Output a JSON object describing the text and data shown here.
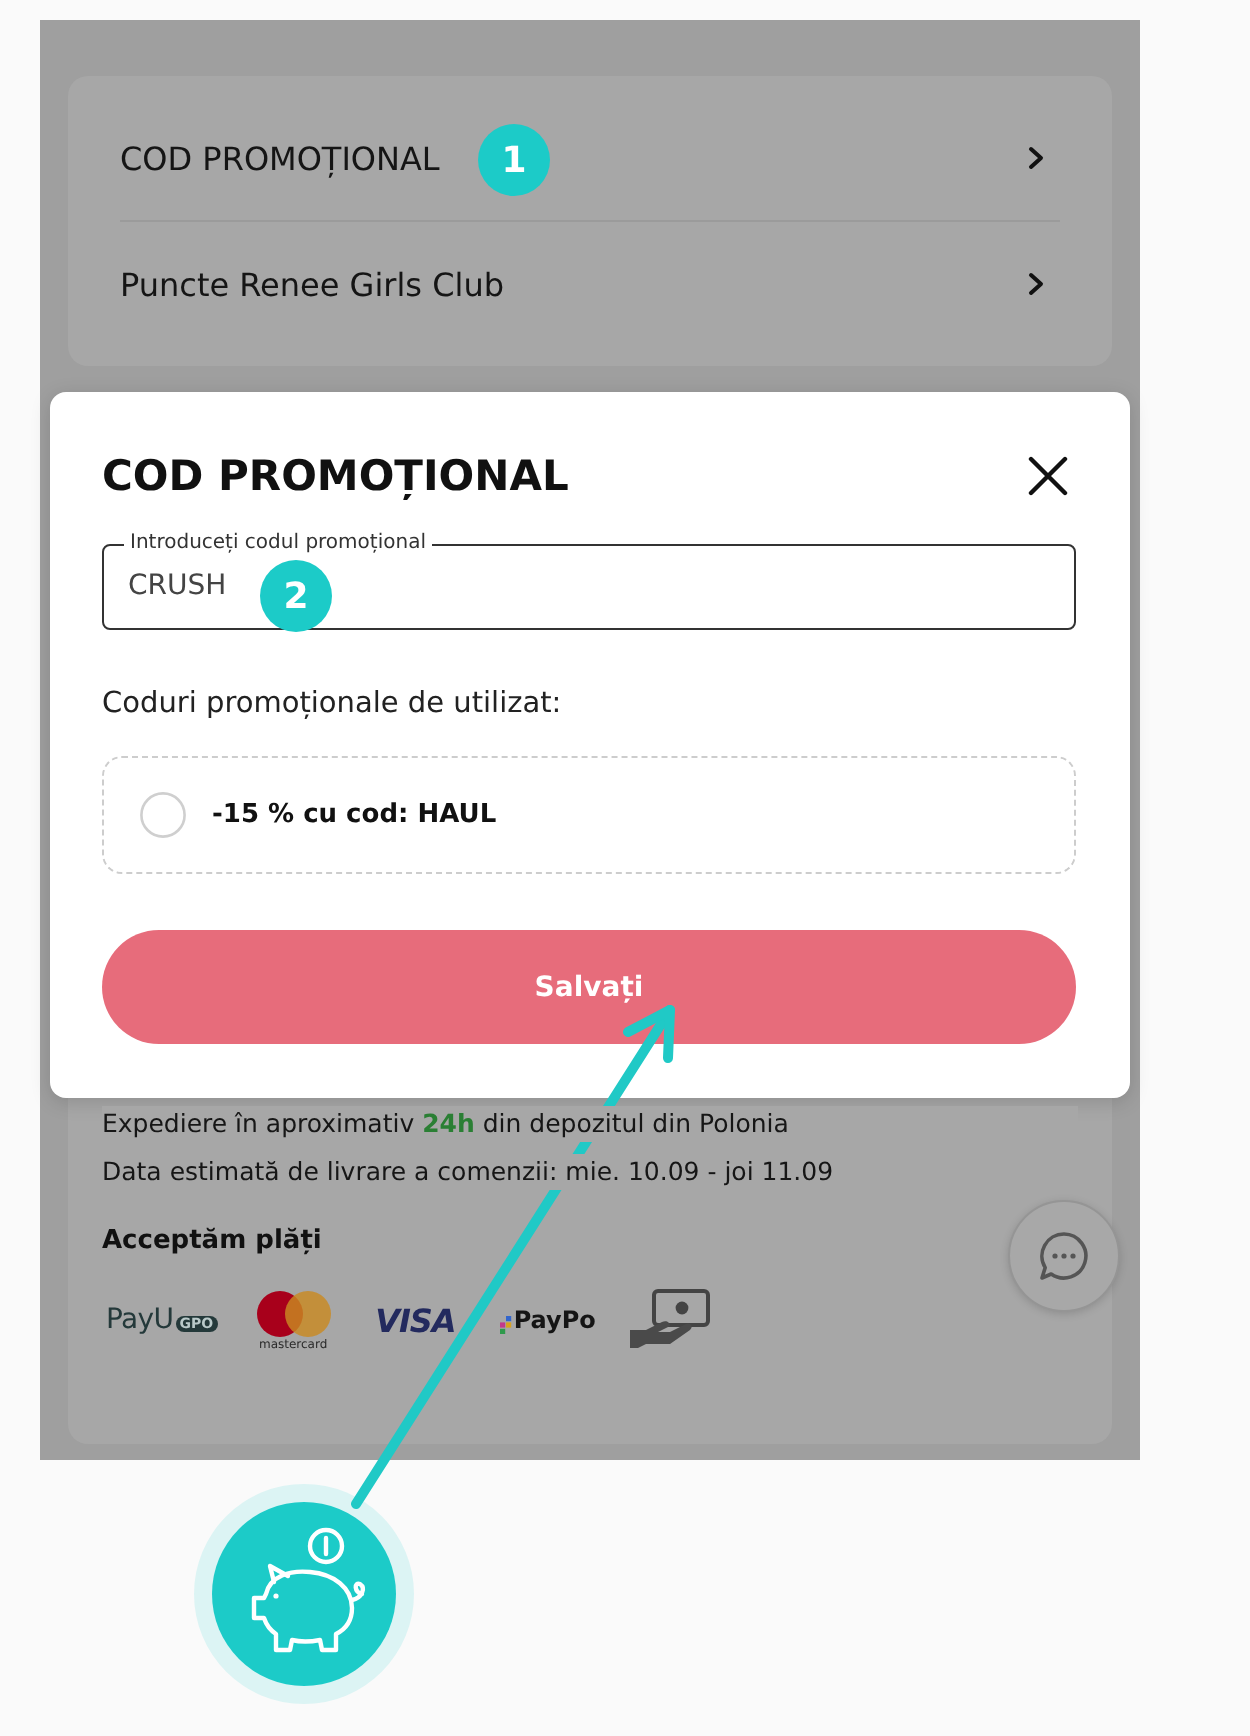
{
  "screen": {
    "menu": [
      {
        "label": "COD PROMOȚIONAL"
      },
      {
        "label": "Puncte Renee Girls Club"
      }
    ],
    "info": {
      "lines": [
        "Expediere în aproximativ **24h** din depozitul din Polonia",
        "Data estimată de livrare a comenzii: mie. 10.09 - joi 11.09"
      ],
      "payments_title": "Acceptăm plăți",
      "payment_methods": [
        {
          "kind": "payu",
          "label": "PayU",
          "badge": "GPO"
        },
        {
          "kind": "mastercard",
          "caption": "mastercard"
        },
        {
          "kind": "visa",
          "label": "VISA"
        },
        {
          "kind": "paypo",
          "label": "PayPo"
        },
        {
          "kind": "cash"
        }
      ]
    }
  },
  "dialog": {
    "title": "COD PROMOȚIONAL",
    "field": {
      "label": "Introduceți codul promoțional",
      "value": "CRUSH"
    },
    "section_label": "Coduri promoționale de utilizat:",
    "options": [
      {
        "label": "-15 % cu cod: HAUL",
        "selected": false
      }
    ],
    "button": "Salvați"
  },
  "callouts": [
    {
      "label": "1"
    },
    {
      "label": "2"
    }
  ]
}
